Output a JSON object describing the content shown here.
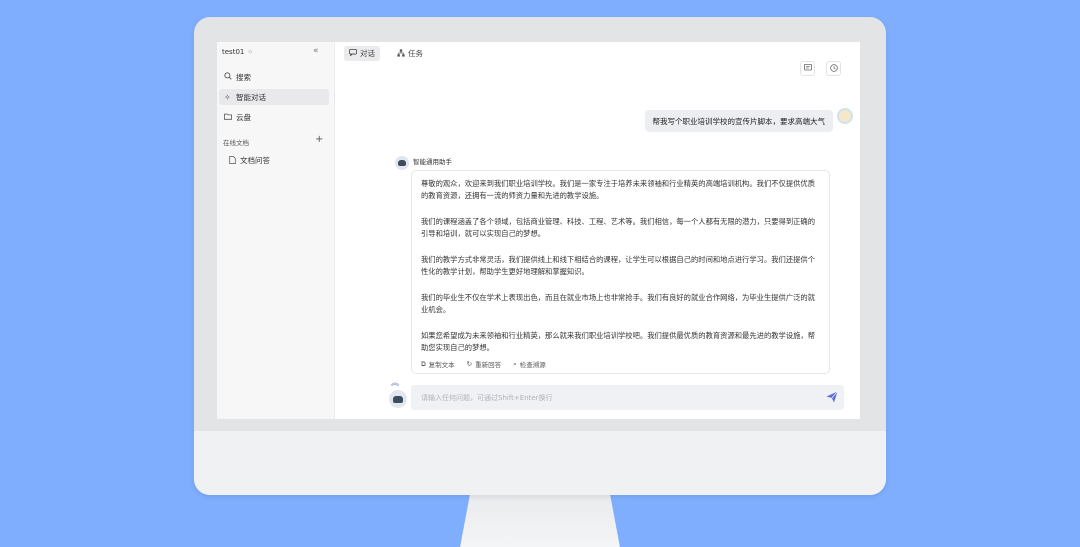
{
  "sidebar": {
    "workspace": "test01",
    "nav": [
      {
        "label": "搜索",
        "icon": "search-icon"
      },
      {
        "label": "智能对话",
        "icon": "sparkle-icon"
      },
      {
        "label": "云盘",
        "icon": "folder-icon"
      }
    ],
    "section_title": "在线文档",
    "doc_item": "文档问答"
  },
  "tabs": [
    {
      "label": "对话",
      "icon": "chat-icon"
    },
    {
      "label": "任务",
      "icon": "tasks-icon"
    }
  ],
  "chat": {
    "user_message": "帮我写个职业培训学校的宣传片脚本，要求高端大气",
    "bot_name": "智能通用助手",
    "bot_paragraphs": [
      "尊敬的观众，欢迎来到我们职业培训学校。我们是一家专注于培养未来领袖和行业精英的高端培训机构。我们不仅提供优质的教育资源，还拥有一流的师资力量和先进的教学设施。",
      "我们的课程涵盖了各个领域，包括商业管理、科技、工程、艺术等。我们相信，每一个人都有无限的潜力，只要得到正确的引导和培训，就可以实现自己的梦想。",
      "我们的教学方式非常灵活，我们提供线上和线下相结合的课程，让学生可以根据自己的时间和地点进行学习。我们还提供个性化的教学计划，帮助学生更好地理解和掌握知识。",
      "我们的毕业生不仅在学术上表现出色，而且在就业市场上也非常抢手。我们有良好的就业合作网络，为毕业生提供广泛的就业机会。",
      "如果您希望成为未来领袖和行业精英，那么就来我们职业培训学校吧。我们提供最优质的教育资源和最先进的教学设施，帮助您实现自己的梦想。"
    ],
    "actions": {
      "copy": "复制文本",
      "regenerate": "重新回答",
      "trace": "检查溯源"
    }
  },
  "input": {
    "placeholder": "请输入任何问题，可通过Shift+Enter换行"
  },
  "colors": {
    "background": "#7eaefd",
    "accent": "#5a6fd8"
  }
}
